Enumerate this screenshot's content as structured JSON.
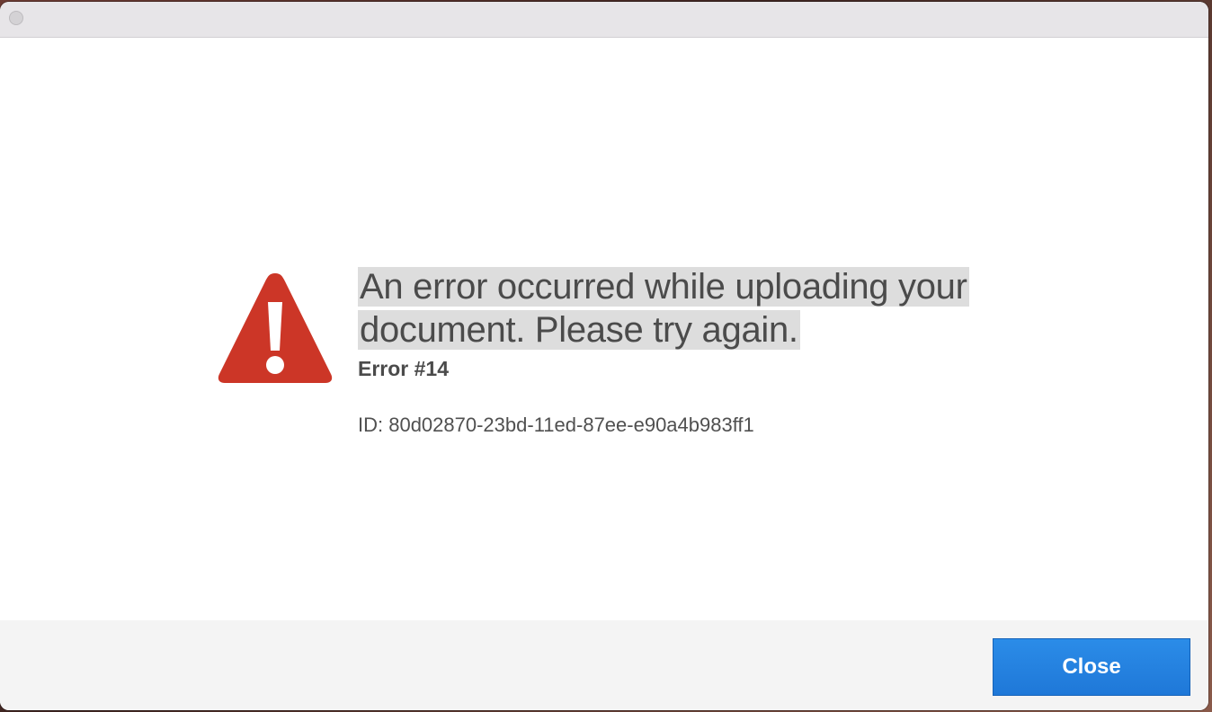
{
  "dialog": {
    "headline": "An error occurred while uploading your document. Please try again.",
    "error_code": "Error #14",
    "error_id": "ID: 80d02870-23bd-11ed-87ee-e90a4b983ff1",
    "icon": "warning-triangle-icon",
    "icon_color": "#cc3627"
  },
  "footer": {
    "close_label": "Close"
  },
  "colors": {
    "accent": "#1f78d8",
    "text": "#4b4b4b",
    "highlight": "#dddddd"
  }
}
